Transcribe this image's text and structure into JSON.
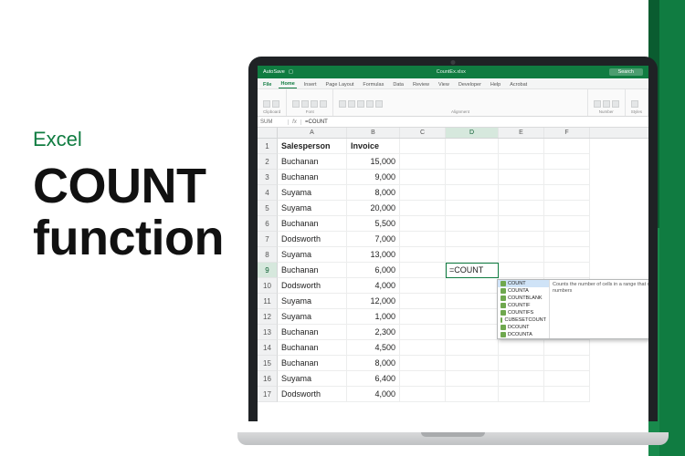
{
  "promo": {
    "brand": "Excel",
    "line1": "COUNT",
    "line2": "function"
  },
  "titlebar": {
    "autosave": "AutoSave",
    "doc": "CountEx.xlsx",
    "search": "Search"
  },
  "ribbon": {
    "file": "File",
    "tabs": [
      "Home",
      "Insert",
      "Page Layout",
      "Formulas",
      "Data",
      "Review",
      "View",
      "Developer",
      "Help",
      "Acrobat"
    ],
    "groups": [
      "Clipboard",
      "Font",
      "Alignment",
      "Number",
      "Styles"
    ]
  },
  "fx": {
    "cell": "SUM",
    "symbol": "fx",
    "formula": "=COUNT"
  },
  "grid": {
    "columns": [
      "A",
      "B",
      "C",
      "D",
      "E",
      "F"
    ],
    "headers": {
      "A": "Salesperson",
      "B": "Invoice"
    },
    "active_cell_text": "=COUNT",
    "rows": [
      {
        "n": 2,
        "A": "Buchanan",
        "B": "15,000"
      },
      {
        "n": 3,
        "A": "Buchanan",
        "B": "9,000"
      },
      {
        "n": 4,
        "A": "Suyama",
        "B": "8,000"
      },
      {
        "n": 5,
        "A": "Suyama",
        "B": "20,000"
      },
      {
        "n": 6,
        "A": "Buchanan",
        "B": "5,500"
      },
      {
        "n": 7,
        "A": "Dodsworth",
        "B": "7,000"
      },
      {
        "n": 8,
        "A": "Suyama",
        "B": "13,000"
      },
      {
        "n": 9,
        "A": "Buchanan",
        "B": "6,000"
      },
      {
        "n": 10,
        "A": "Dodsworth",
        "B": "4,000"
      },
      {
        "n": 11,
        "A": "Suyama",
        "B": "12,000"
      },
      {
        "n": 12,
        "A": "Suyama",
        "B": "1,000"
      },
      {
        "n": 13,
        "A": "Buchanan",
        "B": "2,300"
      },
      {
        "n": 14,
        "A": "Buchanan",
        "B": "4,500"
      },
      {
        "n": 15,
        "A": "Buchanan",
        "B": "8,000"
      },
      {
        "n": 16,
        "A": "Suyama",
        "B": "6,400"
      },
      {
        "n": 17,
        "A": "Dodsworth",
        "B": "4,000"
      }
    ]
  },
  "autocomplete": {
    "items": [
      "COUNT",
      "COUNTA",
      "COUNTBLANK",
      "COUNTIF",
      "COUNTIFS",
      "CUBESETCOUNT",
      "DCOUNT",
      "DCOUNTA"
    ],
    "description": "Counts the number of cells in a range that contain numbers"
  }
}
